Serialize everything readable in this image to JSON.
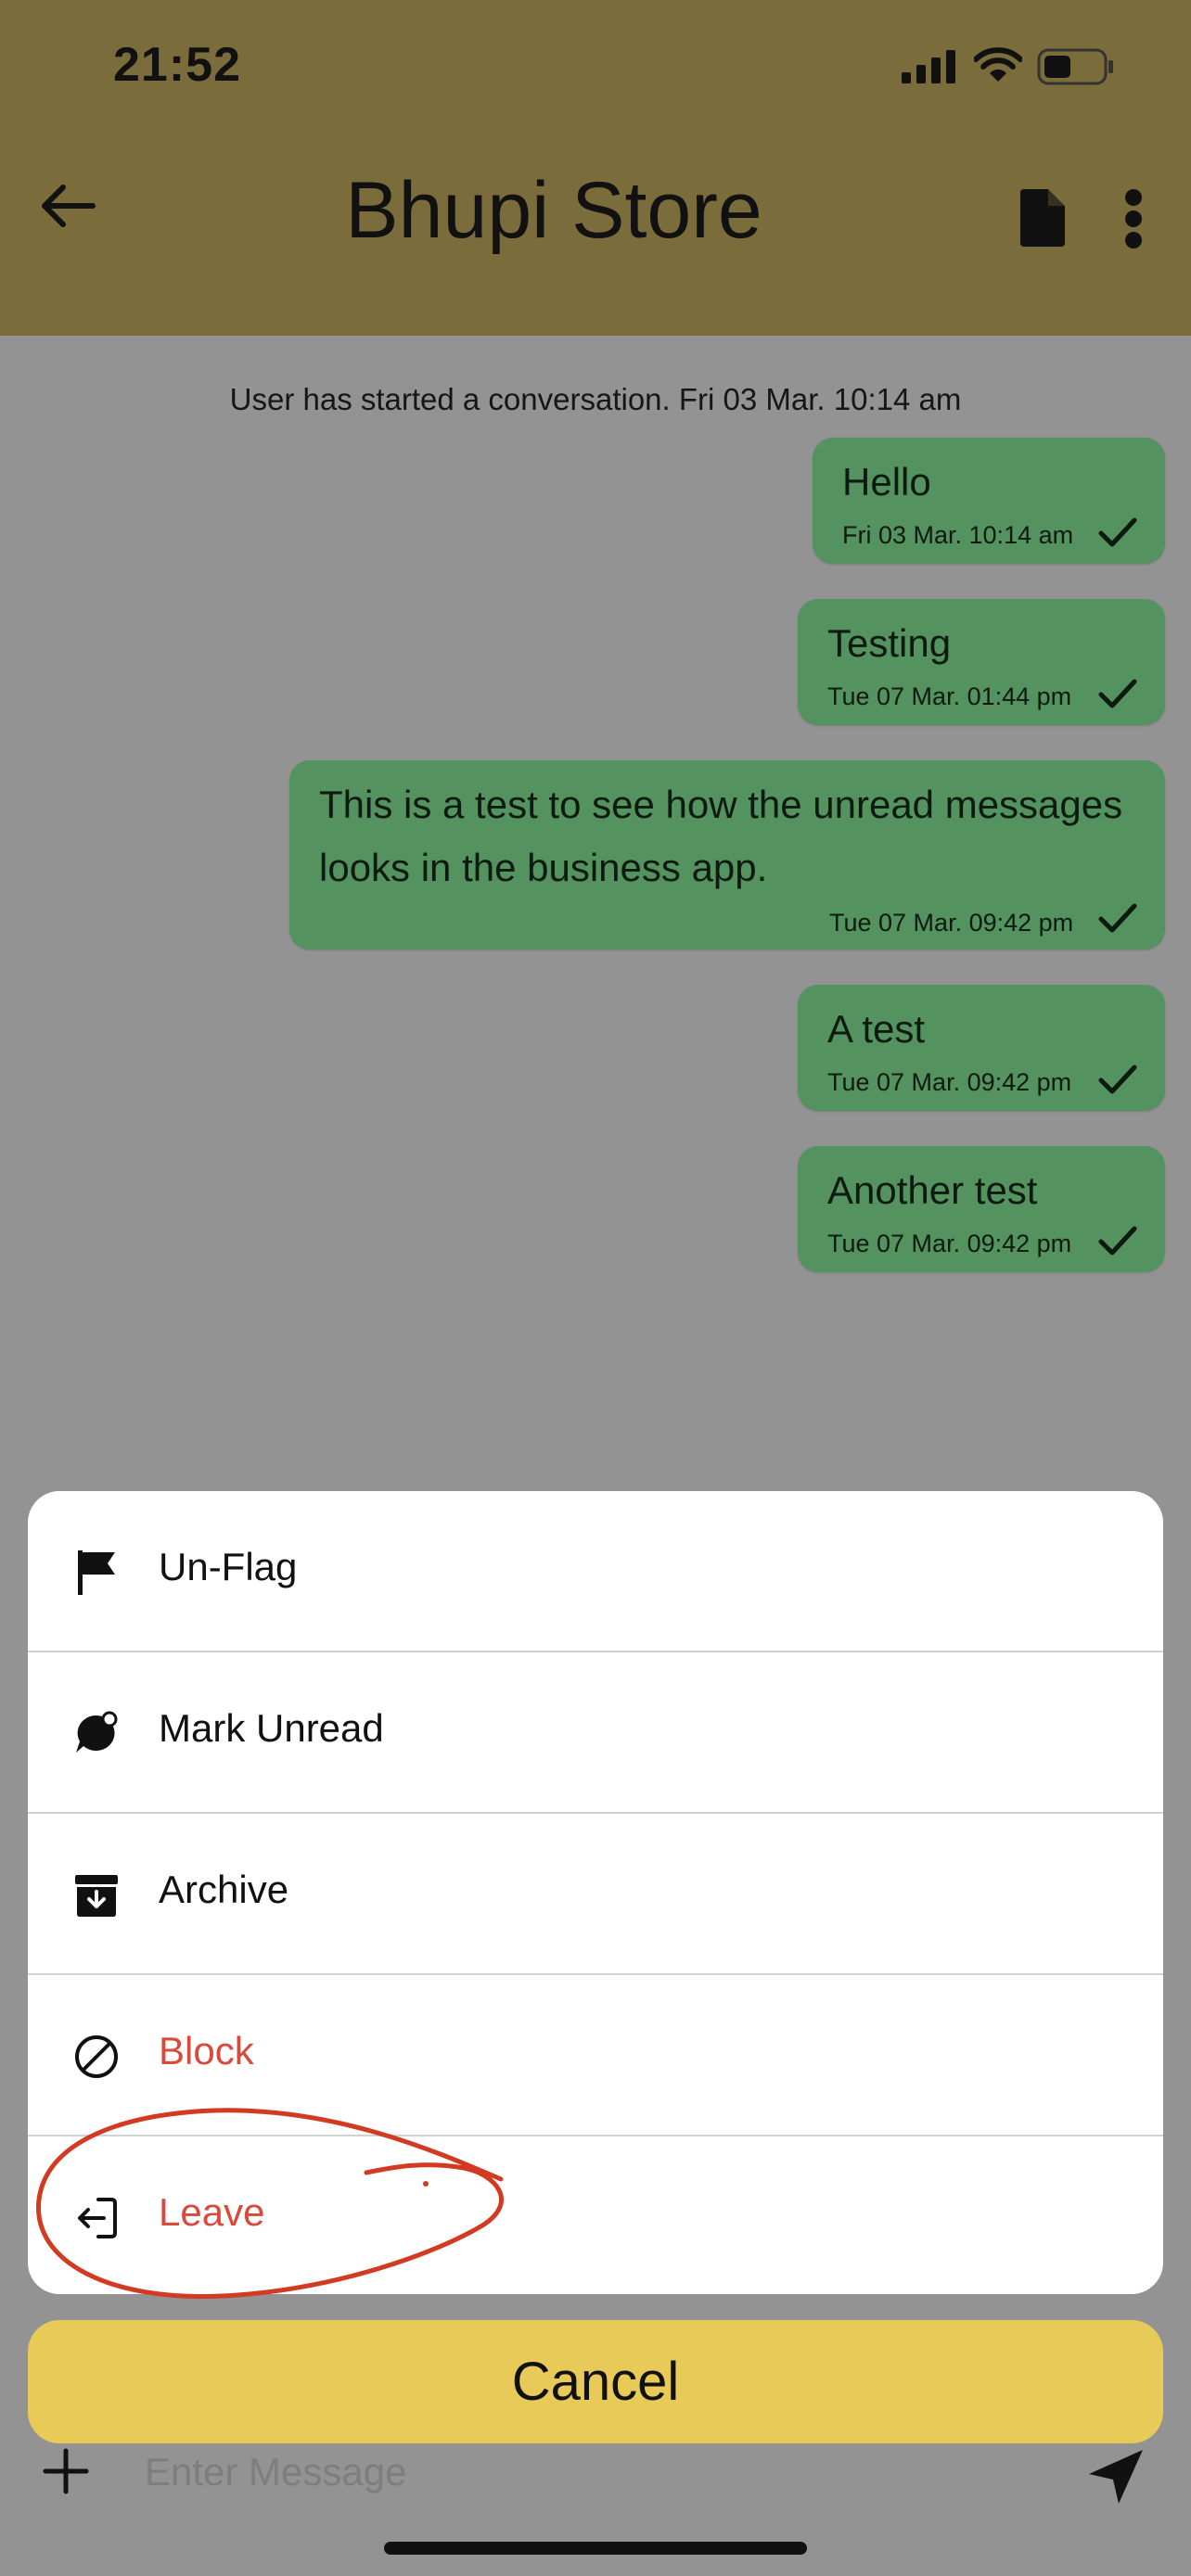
{
  "status_bar": {
    "time": "21:52"
  },
  "header": {
    "title": "Bhupi Store"
  },
  "chat": {
    "system_note": "User has started a conversation. Fri 03 Mar. 10:14 am",
    "messages": [
      {
        "text": "Hello",
        "time": "Fri 03 Mar. 10:14 am"
      },
      {
        "text": "Testing",
        "time": "Tue 07 Mar. 01:44 pm"
      },
      {
        "line1": "This is a test to see how the unread messages",
        "line2": "looks in the business app.",
        "time": "Tue 07 Mar. 09:42 pm"
      },
      {
        "text": "A test",
        "time": "Tue 07 Mar. 09:42 pm"
      },
      {
        "text": "Another test",
        "time": "Tue 07 Mar. 09:42 pm"
      }
    ]
  },
  "action_sheet": {
    "items": [
      {
        "label": "Un-Flag",
        "icon": "flag-icon"
      },
      {
        "label": "Mark Unread",
        "icon": "chat-bubble-dot-icon"
      },
      {
        "label": "Archive",
        "icon": "archive-box-icon"
      },
      {
        "label": "Block",
        "icon": "block-icon",
        "color": "#d94a3a"
      },
      {
        "label": "Leave",
        "icon": "exit-icon",
        "color": "#d94a3a"
      }
    ],
    "cancel_label": "Cancel"
  },
  "composer": {
    "placeholder": "Enter Message"
  },
  "colors": {
    "header_bg": "#7b6d3b",
    "bubble_bg": "#549260",
    "cancel_bg": "#e8ca58",
    "danger": "#d94a3a",
    "annotation": "#d23a22"
  }
}
